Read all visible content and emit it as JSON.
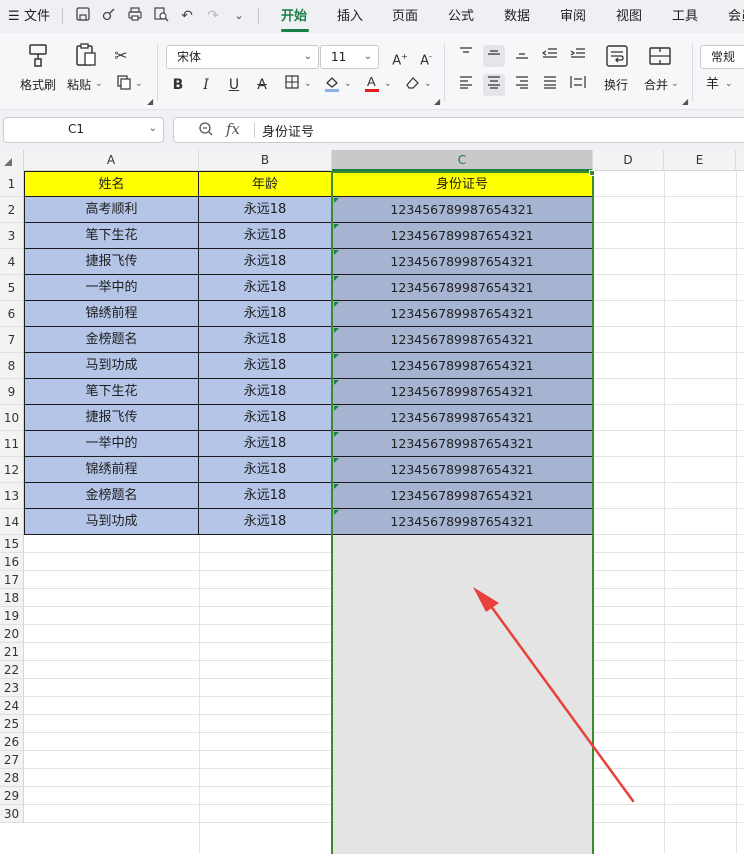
{
  "menu": {
    "app_menu_icon": "hamburger-icon",
    "file_label": "文件",
    "tabs": [
      "开始",
      "插入",
      "页面",
      "公式",
      "数据",
      "审阅",
      "视图",
      "工具",
      "会员"
    ],
    "active_tab": "开始"
  },
  "ribbon": {
    "format_painter_label": "格式刷",
    "paste_label": "粘贴",
    "font_name": "宋体",
    "font_size": "11",
    "wrap_label": "换行",
    "merge_label": "合并",
    "number_format": "常规",
    "currency_symbol": "羊"
  },
  "formula_bar": {
    "cell_ref": "C1",
    "fx_label": "fx",
    "content": "身份证号"
  },
  "sheet": {
    "columns": [
      "A",
      "B",
      "C",
      "D",
      "E"
    ],
    "selected_column": "C",
    "rows": [
      "1",
      "2",
      "3",
      "4",
      "5",
      "6",
      "7",
      "8",
      "9",
      "10",
      "11",
      "12",
      "13",
      "14",
      "15",
      "16",
      "17",
      "18",
      "19",
      "20",
      "21",
      "22",
      "23",
      "24",
      "25",
      "26",
      "27",
      "28",
      "29",
      "30"
    ],
    "headers": [
      "姓名",
      "年龄",
      "身份证号"
    ],
    "data": [
      [
        "高考顺利",
        "永远18",
        "123456789987654321"
      ],
      [
        "笔下生花",
        "永远18",
        "123456789987654321"
      ],
      [
        "捷报飞传",
        "永远18",
        "123456789987654321"
      ],
      [
        "一举中的",
        "永远18",
        "123456789987654321"
      ],
      [
        "锦绣前程",
        "永远18",
        "123456789987654321"
      ],
      [
        "金榜题名",
        "永远18",
        "123456789987654321"
      ],
      [
        "马到功成",
        "永远18",
        "123456789987654321"
      ],
      [
        "笔下生花",
        "永远18",
        "123456789987654321"
      ],
      [
        "捷报飞传",
        "永远18",
        "123456789987654321"
      ],
      [
        "一举中的",
        "永远18",
        "123456789987654321"
      ],
      [
        "锦绣前程",
        "永远18",
        "123456789987654321"
      ],
      [
        "金榜题名",
        "永远18",
        "123456789987654321"
      ],
      [
        "马到功成",
        "永远18",
        "123456789987654321"
      ]
    ]
  },
  "colors": {
    "accent": "#1a7f45",
    "header_fill": "#ffff00",
    "data_fill": "#b4c5e8",
    "selection_fill": "#a6b4d2",
    "arrow": "#e8413c"
  }
}
